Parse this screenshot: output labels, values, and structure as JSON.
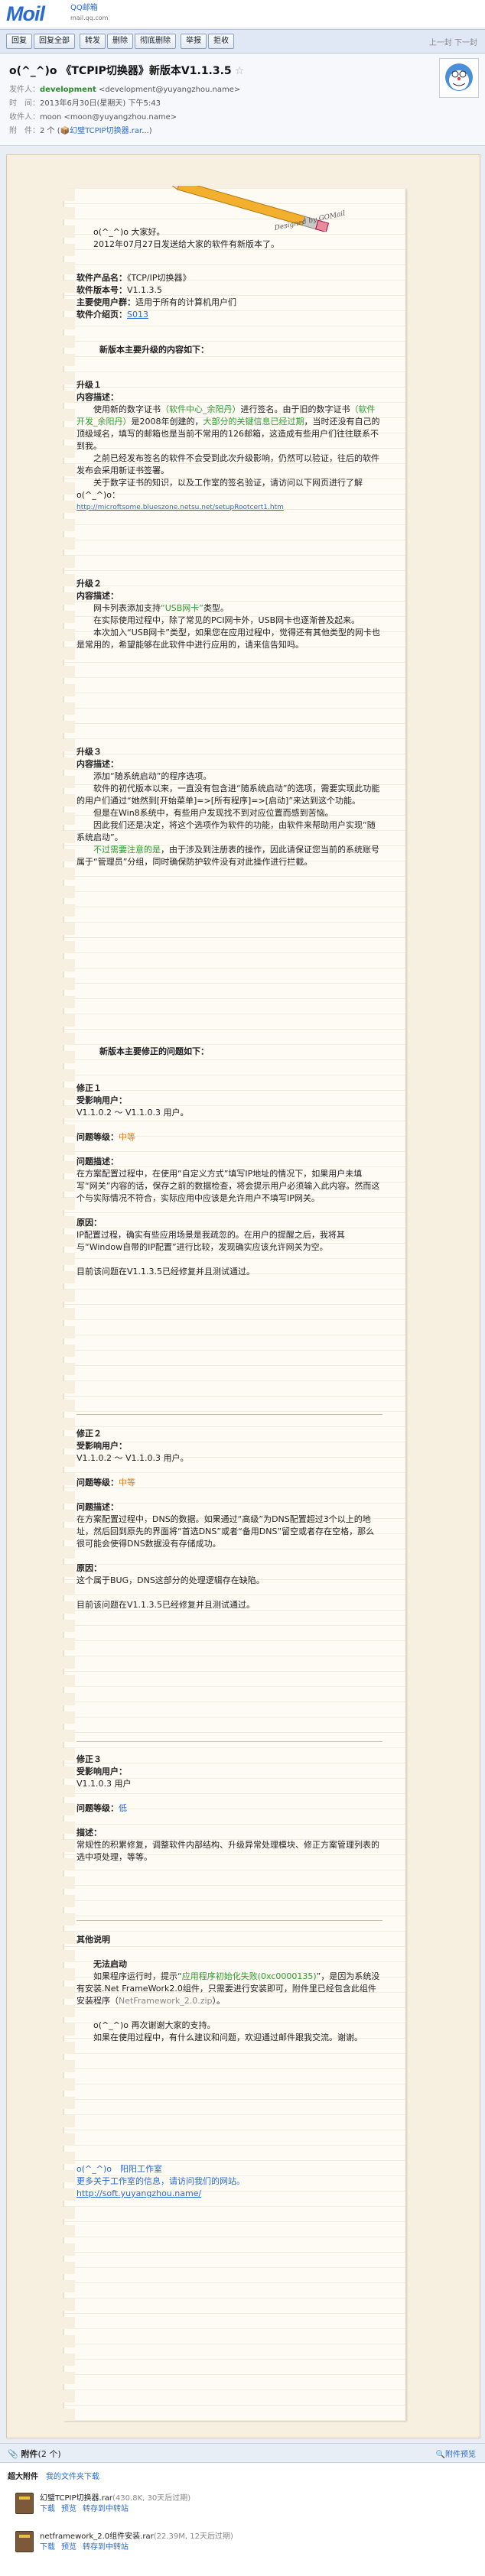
{
  "logo": {
    "brand": "Moil",
    "sub1": "QQ邮箱",
    "sub2": "mail.qq.com"
  },
  "toolbar": {
    "buttons": [
      "回复",
      "回复全部",
      "转发",
      "删除",
      "彻底删除",
      "举报",
      "拒收"
    ],
    "pager": "上一封 下一封"
  },
  "header": {
    "subject": "o(^_^)o 《TCPIP切换器》新版本V1.1.3.5",
    "star": "☆",
    "from_label": "发件人：",
    "from_name": "development",
    "from_addr": "<development@yuyangzhou.name>",
    "time_label": "时　间：",
    "time_value": "2013年6月30日(星期天) 下午5:43",
    "to_label": "收件人：",
    "to_value": "moon <moon@yuyangzhou.name>",
    "attach_label": "附　件：",
    "attach_count": "2 个 (",
    "attach_name": "幻璧TCPIP切换器.rar",
    "attach_tail": "...)"
  },
  "letter": {
    "greeting": "o(^_^)o 大家好。",
    "intro": "2012年07月27日发送给大家的软件有新版本了。",
    "product_label": "软件产品名：",
    "product_value": "《TCP/IP切换器》",
    "version_label": "软件版本号：",
    "version_value": "V1.1.3.5",
    "users_label": "主要使用户群：",
    "users_value": "适用于所有的计算机用户们",
    "intro_label": "软件介绍页：",
    "intro_link": "S013",
    "section1_title": "新版本主要升级的内容如下：",
    "up1_title": "升级１",
    "up1_desc_label": "内容描述：",
    "up1_p1a": "使用新的数字证书",
    "up1_p1b": "（软件中心_余阳丹）",
    "up1_p1c": "进行签名。由于旧的数字证书",
    "up1_p1d": "（软件开发_余阳丹）",
    "up1_p1e": "是2008年创建的，",
    "up1_p1f": "大部分的关键信息已经过期",
    "up1_p1g": "，当时还没有自己的顶级域名，填写的邮箱也是当前不常用的126邮箱，这造成有些用户们往往联系不到我。",
    "up1_p2": "之前已经发布签名的软件不会受到此次升级影响，仍然可以验证，往后的软件发布会采用新证书签署。",
    "up1_p3": "关于数字证书的知识，以及工作室的签名验证，请访问以下网页进行了解 o(^_^)o：",
    "up1_link": "http://microftsome.blueszone.netsu.net/setupRootcert1.htm",
    "up2_title": "升级２",
    "up2_desc_label": "内容描述：",
    "up2_p1a": "网卡列表添加支持",
    "up2_p1b": "“USB网卡”",
    "up2_p1c": "类型。",
    "up2_p2": "在实际使用过程中，除了常见的PCI网卡外，USB网卡也逐渐普及起来。",
    "up2_p3": "本次加入“USB网卡”类型，如果您在应用过程中，觉得还有其他类型的网卡也是常用的，希望能够在此软件中进行应用的，请来信告知吗。",
    "up3_title": "升级３",
    "up3_desc_label": "内容描述：",
    "up3_p1": "添加“随系统启动”的程序选项。",
    "up3_p2": "软件的初代版本以来，一直没有包含进“随系统启动”的选项，需要实现此功能的用户们通过“她然到[开始菜单]=>[所有程序]=>[启动]”来达到这个功能。",
    "up3_p3": "但是在Win8系统中，有些用户发现找不到对应位置而感到苦恼。",
    "up3_p4": "因此我们还是决定，将这个选项作为软件的功能，由软件来帮助用户实现“随系统启动”。",
    "up3_p5a": "不过需要注意的是",
    "up3_p5b": "，由于涉及到注册表的操作，因此请保证您当前的系统账号属于“管理员”分组，同时确保防护软件没有对此操作进行拦截。",
    "section2_title": "新版本主要修正的问题如下：",
    "fix1_title": "修正１",
    "fix1_users_label": "受影响用户：",
    "fix1_users": "V1.1.0.2 ～ V1.1.0.3 用户。",
    "fix1_level_label": "问题等级：",
    "fix1_level": "中等",
    "fix1_desc_label": "问题描述：",
    "fix1_desc": "在方案配置过程中，在使用“自定义方式”填写IP地址的情况下，如果用户未填写“网关”内容的话，保存之前的数据检查，将会提示用户必须输入此内容。然而这个与实际情况不符合，实际应用中应该是允许用户不填写IP网关。",
    "fix1_cause_label": "原因：",
    "fix1_cause": "IP配置过程，确实有些应用场景是我疏忽的。在用户的提醒之后，我将其与“Window自带的IP配置”进行比较，发现确实应该允许网关为空。",
    "fix1_status": "目前该问题在V1.1.3.5已经修复并且测试通过。",
    "fix2_title": "修正２",
    "fix2_users_label": "受影响用户：",
    "fix2_users": "V1.1.0.2 ～ V1.1.0.3 用户。",
    "fix2_level_label": "问题等级：",
    "fix2_level": "中等",
    "fix2_desc_label": "问题描述：",
    "fix2_desc": "在方案配置过程中，DNS的数据。如果通过“高级”为DNS配置超过3个以上的地址，然后回到原先的界面将“首选DNS”或者“备用DNS”留空或者存在空格，那么很可能会使得DNS数据没有存储成功。",
    "fix2_cause_label": "原因：",
    "fix2_cause": "这个属于BUG，DNS这部分的处理逻辑存在缺陷。",
    "fix2_status": "目前该问题在V1.1.3.5已经修复并且测试通过。",
    "fix3_title": "修正３",
    "fix3_users_label": "受影响用户：",
    "fix3_users": "V1.1.0.3 用户",
    "fix3_level_label": "问题等级：",
    "fix3_level": "低",
    "fix3_desc_label": "描述：",
    "fix3_desc": "常规性的积累修复，调整软件内部结构、升级异常处理模块、修正方案管理列表的选中项处理，等等。",
    "other_title": "其他说明",
    "other_sub": "无法启动",
    "other_p1a": "如果程序运行时，提示“",
    "other_p1b": "应用程序初始化失败(0xc0000135)",
    "other_p1c": "”，是因为系统没有安装.Net FrameWork2.0组件，只需要进行安装即可，附件里已经包含此组件安装程序（",
    "other_p1d": "NetFramework_2.0.zip",
    "other_p1e": "）。",
    "thanks": "o(^_^)o 再次谢谢大家的支持。",
    "feedback": "如果在使用过程中，有什么建议和问题，欢迎通过邮件跟我交流。谢谢。",
    "sig1": "o(^_^)o　阳阳工作室",
    "sig2": "更多关于工作室的信息，请访问我们的网站。",
    "sig_link": "http://soft.yuyangzhou.name/"
  },
  "attachments": {
    "title": "附件",
    "count": "(2 个)",
    "preview": "附件预览",
    "sub_label": "超大附件",
    "sub_link": "我的文件夹下载",
    "files": [
      {
        "name": "幻璧TCPIP切换器.rar",
        "size": "(430.8K, 30天后过期)",
        "actions": [
          "下载",
          "预览",
          "转存到中转站"
        ]
      },
      {
        "name": "netframework_2.0组件安装.rar",
        "size": "(22.39M, 12天后过期)",
        "actions": [
          "下载",
          "预览",
          "转存到中转站"
        ]
      }
    ]
  }
}
